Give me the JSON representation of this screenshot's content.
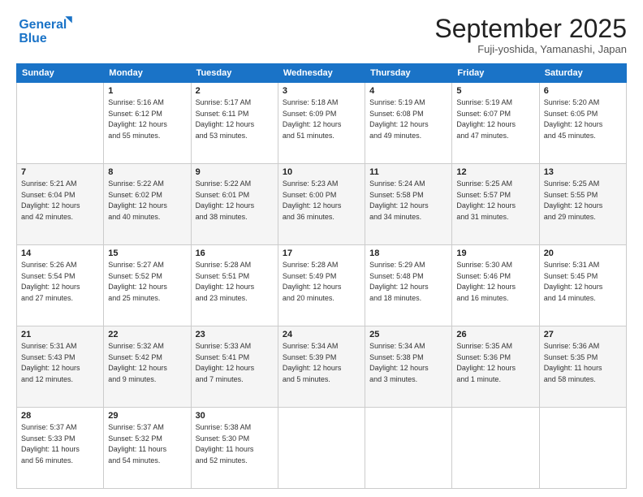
{
  "logo": {
    "line1": "General",
    "line2": "Blue"
  },
  "header": {
    "title": "September 2025",
    "subtitle": "Fuji-yoshida, Yamanashi, Japan"
  },
  "weekdays": [
    "Sunday",
    "Monday",
    "Tuesday",
    "Wednesday",
    "Thursday",
    "Friday",
    "Saturday"
  ],
  "weeks": [
    [
      {
        "day": "",
        "info": ""
      },
      {
        "day": "1",
        "info": "Sunrise: 5:16 AM\nSunset: 6:12 PM\nDaylight: 12 hours\nand 55 minutes."
      },
      {
        "day": "2",
        "info": "Sunrise: 5:17 AM\nSunset: 6:11 PM\nDaylight: 12 hours\nand 53 minutes."
      },
      {
        "day": "3",
        "info": "Sunrise: 5:18 AM\nSunset: 6:09 PM\nDaylight: 12 hours\nand 51 minutes."
      },
      {
        "day": "4",
        "info": "Sunrise: 5:19 AM\nSunset: 6:08 PM\nDaylight: 12 hours\nand 49 minutes."
      },
      {
        "day": "5",
        "info": "Sunrise: 5:19 AM\nSunset: 6:07 PM\nDaylight: 12 hours\nand 47 minutes."
      },
      {
        "day": "6",
        "info": "Sunrise: 5:20 AM\nSunset: 6:05 PM\nDaylight: 12 hours\nand 45 minutes."
      }
    ],
    [
      {
        "day": "7",
        "info": "Sunrise: 5:21 AM\nSunset: 6:04 PM\nDaylight: 12 hours\nand 42 minutes."
      },
      {
        "day": "8",
        "info": "Sunrise: 5:22 AM\nSunset: 6:02 PM\nDaylight: 12 hours\nand 40 minutes."
      },
      {
        "day": "9",
        "info": "Sunrise: 5:22 AM\nSunset: 6:01 PM\nDaylight: 12 hours\nand 38 minutes."
      },
      {
        "day": "10",
        "info": "Sunrise: 5:23 AM\nSunset: 6:00 PM\nDaylight: 12 hours\nand 36 minutes."
      },
      {
        "day": "11",
        "info": "Sunrise: 5:24 AM\nSunset: 5:58 PM\nDaylight: 12 hours\nand 34 minutes."
      },
      {
        "day": "12",
        "info": "Sunrise: 5:25 AM\nSunset: 5:57 PM\nDaylight: 12 hours\nand 31 minutes."
      },
      {
        "day": "13",
        "info": "Sunrise: 5:25 AM\nSunset: 5:55 PM\nDaylight: 12 hours\nand 29 minutes."
      }
    ],
    [
      {
        "day": "14",
        "info": "Sunrise: 5:26 AM\nSunset: 5:54 PM\nDaylight: 12 hours\nand 27 minutes."
      },
      {
        "day": "15",
        "info": "Sunrise: 5:27 AM\nSunset: 5:52 PM\nDaylight: 12 hours\nand 25 minutes."
      },
      {
        "day": "16",
        "info": "Sunrise: 5:28 AM\nSunset: 5:51 PM\nDaylight: 12 hours\nand 23 minutes."
      },
      {
        "day": "17",
        "info": "Sunrise: 5:28 AM\nSunset: 5:49 PM\nDaylight: 12 hours\nand 20 minutes."
      },
      {
        "day": "18",
        "info": "Sunrise: 5:29 AM\nSunset: 5:48 PM\nDaylight: 12 hours\nand 18 minutes."
      },
      {
        "day": "19",
        "info": "Sunrise: 5:30 AM\nSunset: 5:46 PM\nDaylight: 12 hours\nand 16 minutes."
      },
      {
        "day": "20",
        "info": "Sunrise: 5:31 AM\nSunset: 5:45 PM\nDaylight: 12 hours\nand 14 minutes."
      }
    ],
    [
      {
        "day": "21",
        "info": "Sunrise: 5:31 AM\nSunset: 5:43 PM\nDaylight: 12 hours\nand 12 minutes."
      },
      {
        "day": "22",
        "info": "Sunrise: 5:32 AM\nSunset: 5:42 PM\nDaylight: 12 hours\nand 9 minutes."
      },
      {
        "day": "23",
        "info": "Sunrise: 5:33 AM\nSunset: 5:41 PM\nDaylight: 12 hours\nand 7 minutes."
      },
      {
        "day": "24",
        "info": "Sunrise: 5:34 AM\nSunset: 5:39 PM\nDaylight: 12 hours\nand 5 minutes."
      },
      {
        "day": "25",
        "info": "Sunrise: 5:34 AM\nSunset: 5:38 PM\nDaylight: 12 hours\nand 3 minutes."
      },
      {
        "day": "26",
        "info": "Sunrise: 5:35 AM\nSunset: 5:36 PM\nDaylight: 12 hours\nand 1 minute."
      },
      {
        "day": "27",
        "info": "Sunrise: 5:36 AM\nSunset: 5:35 PM\nDaylight: 11 hours\nand 58 minutes."
      }
    ],
    [
      {
        "day": "28",
        "info": "Sunrise: 5:37 AM\nSunset: 5:33 PM\nDaylight: 11 hours\nand 56 minutes."
      },
      {
        "day": "29",
        "info": "Sunrise: 5:37 AM\nSunset: 5:32 PM\nDaylight: 11 hours\nand 54 minutes."
      },
      {
        "day": "30",
        "info": "Sunrise: 5:38 AM\nSunset: 5:30 PM\nDaylight: 11 hours\nand 52 minutes."
      },
      {
        "day": "",
        "info": ""
      },
      {
        "day": "",
        "info": ""
      },
      {
        "day": "",
        "info": ""
      },
      {
        "day": "",
        "info": ""
      }
    ]
  ]
}
